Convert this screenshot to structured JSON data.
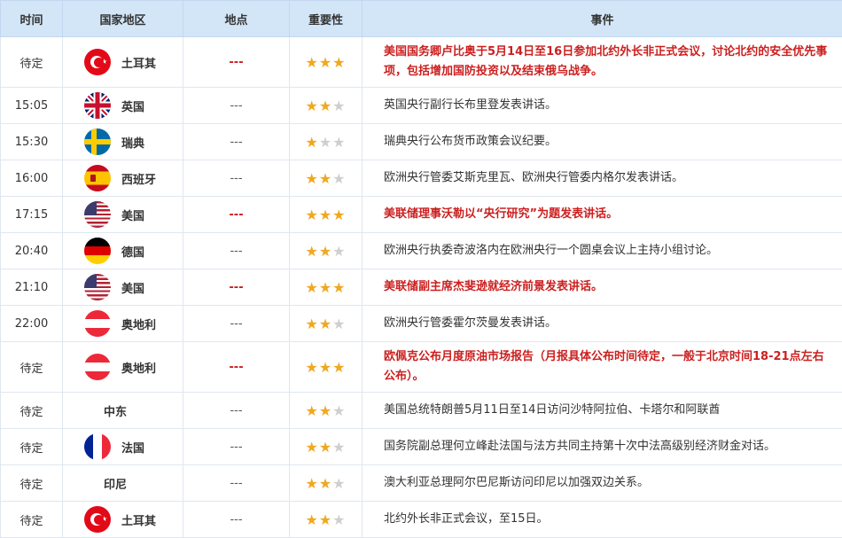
{
  "headers": {
    "time": "时间",
    "country": "国家地区",
    "location": "地点",
    "importance": "重要性",
    "event": "事件"
  },
  "colors": {
    "header_bg": "#d3e6f8",
    "highlight_text": "#cc1f1f",
    "star_on": "#f0a81e",
    "star_off": "#cfcfcf"
  },
  "rows": [
    {
      "time": "待定",
      "flag": "turkey-flag-icon",
      "country": "土耳其",
      "location": "---",
      "stars": 3,
      "event": "美国国务卿卢比奥于5月14日至16日参加北约外长非正式会议，讨论北约的安全优先事项，包括增加国防投资以及结束俄乌战争。"
    },
    {
      "time": "15:05",
      "flag": "uk-flag-icon",
      "country": "英国",
      "location": "---",
      "stars": 2,
      "event": "英国央行副行长布里登发表讲话。"
    },
    {
      "time": "15:30",
      "flag": "sweden-flag-icon",
      "country": "瑞典",
      "location": "---",
      "stars": 1,
      "event": "瑞典央行公布货币政策会议纪要。"
    },
    {
      "time": "16:00",
      "flag": "spain-flag-icon",
      "country": "西班牙",
      "location": "---",
      "stars": 2,
      "event": "欧洲央行管委艾斯克里瓦、欧洲央行管委内格尔发表讲话。"
    },
    {
      "time": "17:15",
      "flag": "us-flag-icon",
      "country": "美国",
      "location": "---",
      "stars": 3,
      "event": "美联储理事沃勒以“央行研究”为题发表讲话。"
    },
    {
      "time": "20:40",
      "flag": "germany-flag-icon",
      "country": "德国",
      "location": "---",
      "stars": 2,
      "event": "欧洲央行执委奇波洛内在欧洲央行一个圆桌会议上主持小组讨论。"
    },
    {
      "time": "21:10",
      "flag": "us-flag-icon",
      "country": "美国",
      "location": "---",
      "stars": 3,
      "event": "美联储副主席杰斐逊就经济前景发表讲话。"
    },
    {
      "time": "22:00",
      "flag": "austria-flag-icon",
      "country": "奥地利",
      "location": "---",
      "stars": 2,
      "event": "欧洲央行管委霍尔茨曼发表讲话。"
    },
    {
      "time": "待定",
      "flag": "austria-flag-icon",
      "country": "奥地利",
      "location": "---",
      "stars": 3,
      "event": "欧佩克公布月度原油市场报告（月报具体公布时间待定，一般于北京时间18-21点左右公布）。"
    },
    {
      "time": "待定",
      "flag": "",
      "country": "中东",
      "location": "---",
      "stars": 2,
      "event": "美国总统特朗普5月11日至14日访问沙特阿拉伯、卡塔尔和阿联酋"
    },
    {
      "time": "待定",
      "flag": "france-flag-icon",
      "country": "法国",
      "location": "---",
      "stars": 2,
      "event": "国务院副总理何立峰赴法国与法方共同主持第十次中法高级别经济财金对话。"
    },
    {
      "time": "待定",
      "flag": "",
      "country": "印尼",
      "location": "---",
      "stars": 2,
      "event": "澳大利亚总理阿尔巴尼斯访问印尼以加强双边关系。"
    },
    {
      "time": "待定",
      "flag": "turkey-flag-icon",
      "country": "土耳其",
      "location": "---",
      "stars": 2,
      "event": "北约外长非正式会议，至15日。"
    }
  ]
}
